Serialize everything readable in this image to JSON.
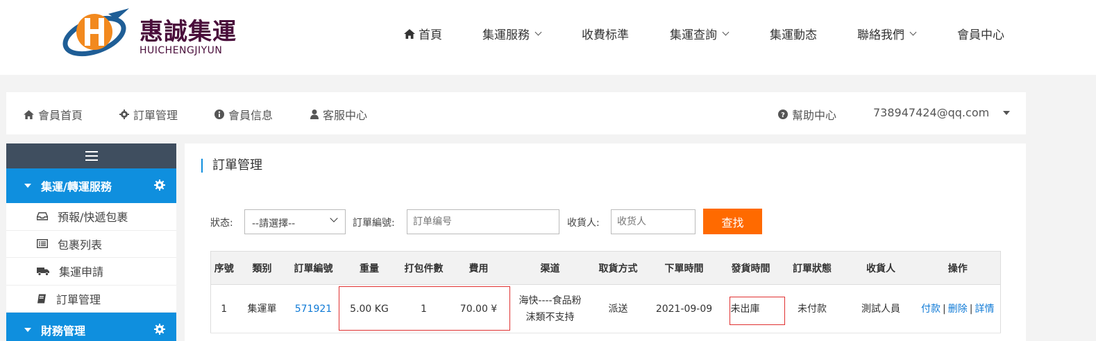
{
  "brand": {
    "name": "惠誠集運",
    "subtitle": "HUICHENGJIYUN",
    "colors": {
      "logo_orange": "#f2891e",
      "logo_blue": "#1f5e96",
      "logo_text": "#4a0e3b"
    }
  },
  "topnav": {
    "items": [
      {
        "label": "首頁",
        "icon": "home-icon"
      },
      {
        "label": "集運服務",
        "dropdown": true
      },
      {
        "label": "收費标準"
      },
      {
        "label": "集運查詢",
        "dropdown": true
      },
      {
        "label": "集運動态"
      },
      {
        "label": "聯絡我們",
        "dropdown": true
      },
      {
        "label": "會員中心"
      }
    ]
  },
  "memberbar": {
    "home": "會員首頁",
    "orders": "訂單管理",
    "info": "會員信息",
    "service": "客服中心",
    "help": "幫助中心",
    "account": "738947424@qq.com"
  },
  "sidebar": {
    "section1": "集運/轉運服務",
    "items": [
      {
        "label": "預報/快遞包裹",
        "icon": "inbox-icon"
      },
      {
        "label": "包裹列表",
        "icon": "list-icon"
      },
      {
        "label": "集運申請",
        "icon": "truck-icon"
      },
      {
        "label": "訂單管理",
        "icon": "book-icon"
      }
    ],
    "section2": "財務管理",
    "accent": "#0f8fde"
  },
  "main": {
    "title": "訂單管理",
    "filters": {
      "status_label": "狀态:",
      "status_value": "--請選擇--",
      "order_label": "訂單編號:",
      "order_placeholder": "訂单编号",
      "receiver_label": "收貨人:",
      "receiver_placeholder": "收货人",
      "search_button": "查找"
    },
    "table": {
      "headers": [
        "序號",
        "類别",
        "訂單編號",
        "重量",
        "打包件數",
        "費用",
        "渠道",
        "取貨方式",
        "下單時間",
        "發貨時間",
        "訂單狀態",
        "收貨人",
        "操作"
      ],
      "rows": [
        {
          "index": "1",
          "type": "集運單",
          "order_no": "571921",
          "weight": "5.00 KG",
          "packages": "1",
          "fee": "70.00 ¥",
          "channel_line1": "海快----食品粉",
          "channel_line2": "沫類不支持",
          "pickup": "派送",
          "order_time": "2021-09-09",
          "ship_time": "未出庫",
          "status": "未付款",
          "receiver": "測試人員",
          "actions": {
            "pay": "付款",
            "delete": "删除",
            "detail": "詳情",
            "separator": "|"
          }
        }
      ]
    }
  }
}
